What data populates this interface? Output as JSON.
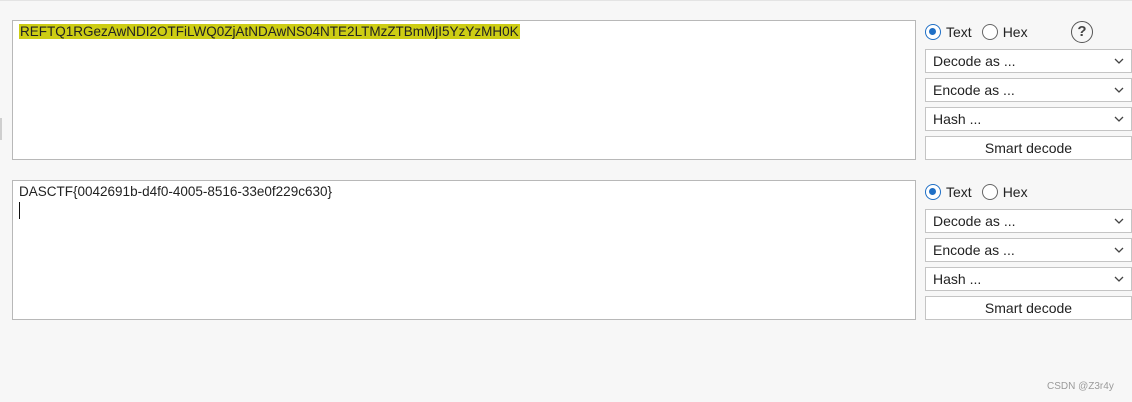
{
  "panels": [
    {
      "input_text": "REFTQ1RGezAwNDI2OTFiLWQ0ZjAtNDAwNS04NTE2LTMzZTBmMjI5YzYzMH0K",
      "radio_text": "Text",
      "radio_hex": "Hex",
      "decode_label": "Decode as ...",
      "encode_label": "Encode as ...",
      "hash_label": "Hash ...",
      "smart_decode_label": "Smart decode",
      "help_label": "?"
    },
    {
      "input_text": "DASCTF{0042691b-d4f0-4005-8516-33e0f229c630}",
      "radio_text": "Text",
      "radio_hex": "Hex",
      "decode_label": "Decode as ...",
      "encode_label": "Encode as ...",
      "hash_label": "Hash ...",
      "smart_decode_label": "Smart decode"
    }
  ],
  "watermark": "CSDN @Z3r4y",
  "colors": {
    "highlight": "#cdcd14",
    "radio_accent": "#1f6fc6"
  },
  "icons": [
    "help-icon",
    "chevron-down-icon"
  ]
}
